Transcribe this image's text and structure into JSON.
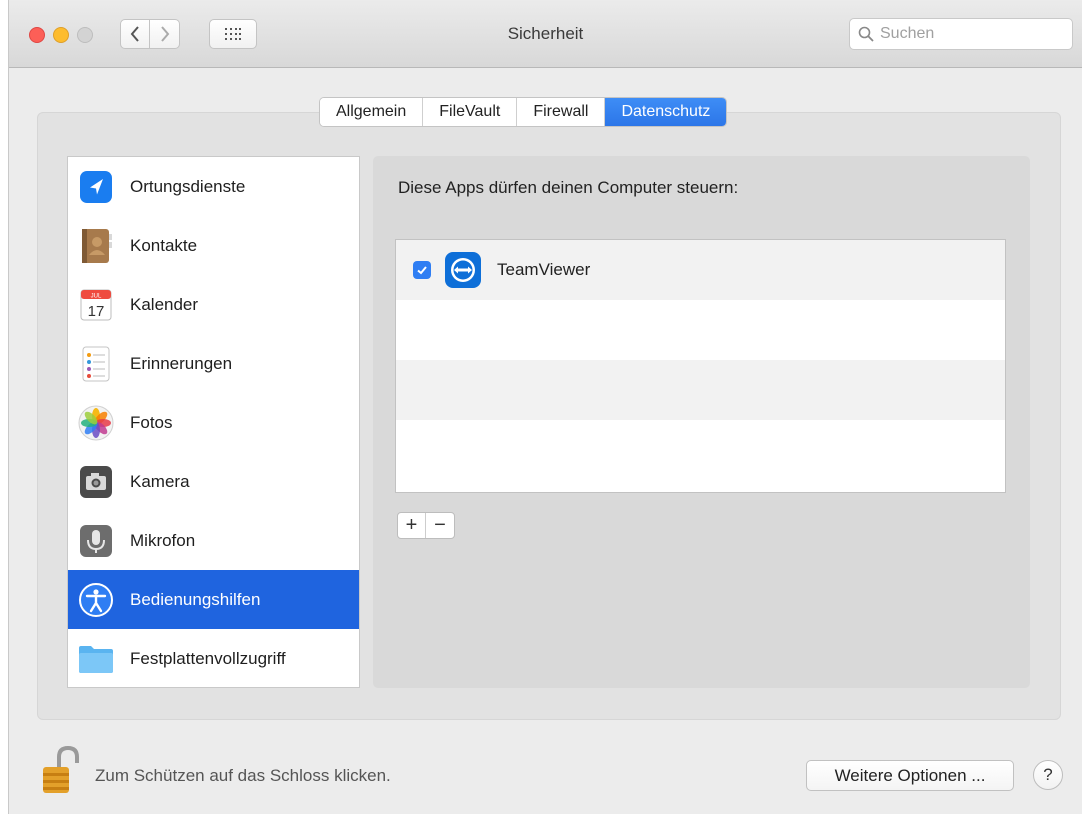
{
  "window": {
    "title": "Sicherheit",
    "search_placeholder": "Suchen"
  },
  "tabs": [
    {
      "label": "Allgemein",
      "active": false
    },
    {
      "label": "FileVault",
      "active": false
    },
    {
      "label": "Firewall",
      "active": false
    },
    {
      "label": "Datenschutz",
      "active": true
    }
  ],
  "categories": [
    {
      "label": "Ortungsdienste",
      "icon": "location-arrow-icon"
    },
    {
      "label": "Kontakte",
      "icon": "contacts-book-icon"
    },
    {
      "label": "Kalender",
      "icon": "calendar-icon",
      "icon_month": "JUL",
      "icon_day": "17"
    },
    {
      "label": "Erinnerungen",
      "icon": "reminders-icon"
    },
    {
      "label": "Fotos",
      "icon": "photos-flower-icon"
    },
    {
      "label": "Kamera",
      "icon": "camera-icon"
    },
    {
      "label": "Mikrofon",
      "icon": "microphone-icon"
    },
    {
      "label": "Bedienungshilfen",
      "icon": "accessibility-icon",
      "selected": true
    },
    {
      "label": "Festplattenvollzugriff",
      "icon": "folder-icon"
    }
  ],
  "main": {
    "heading": "Diese Apps dürfen deinen Computer steuern:",
    "apps": [
      {
        "name": "TeamViewer",
        "checked": true,
        "icon": "teamviewer-icon"
      }
    ],
    "add_label": "+",
    "remove_label": "−"
  },
  "footer": {
    "lock_text": "Zum Schützen auf das Schloss klicken.",
    "more_options_label": "Weitere Optionen ...",
    "help_label": "?"
  },
  "colors": {
    "accent": "#1f64df",
    "tab_active": "#2f7ef3",
    "window_bg": "#ececec"
  }
}
